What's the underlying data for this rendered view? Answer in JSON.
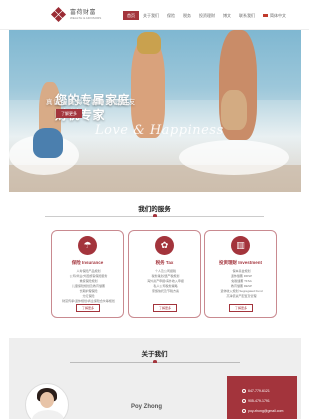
{
  "header": {
    "logo_cn": "富荷财富",
    "logo_en": "WEALTH & ADVISORS",
    "nav": [
      "首页",
      "关于我们",
      "保险",
      "税务",
      "投资理财",
      "博文",
      "联系我们"
    ],
    "language": "简体中文"
  },
  "hero": {
    "title_line1": "您的专属家庭",
    "title_line2": "财税专家",
    "subtitle": "真诚服务每位客户更是朋友",
    "button": "了解更多",
    "script": "Love & Happiness"
  },
  "services": {
    "title": "我们的服务",
    "cards": [
      {
        "icon": "umbrella-icon",
        "glyph": "☂",
        "title": "保险 Insurance",
        "lines": [
          "人寿保险产品规划",
          "公司/商业/外国旅客保险服务",
          "重疾保险规划",
          "儿童保险规划及教育储蓄",
          "长期护理保险",
          "分红保险",
          "财富传承/退休规划/商业保险合伙等规划"
        ],
        "button": "了解更多"
      },
      {
        "icon": "piggy-bank-icon",
        "glyph": "✿",
        "title": "税务 Tax",
        "lines": [
          "个人及公司报税",
          "税务策划/遗产税规划",
          "海外资产申报/海外收入申报",
          "私人公司税务策略",
          "家族信托及节税方案"
        ],
        "button": "了解更多"
      },
      {
        "icon": "chart-icon",
        "glyph": "▥",
        "title": "投资理财 Investment",
        "lines": [
          "保本基金规划",
          "退休储蓄 RRSP",
          "免税储蓄 TFSA",
          "教育储蓄 RESP",
          "退休收入规划 Segregated Fund",
          "高净值资产配置及管理"
        ],
        "button": "了解更多"
      }
    ]
  },
  "about": {
    "title": "关于我们",
    "name": "Poy Zhong",
    "phone1": "647-779-6121",
    "phone2": "905-479-1791",
    "email": "poy.zhong@gmail.com"
  },
  "colors": {
    "accent": "#a3343c"
  }
}
